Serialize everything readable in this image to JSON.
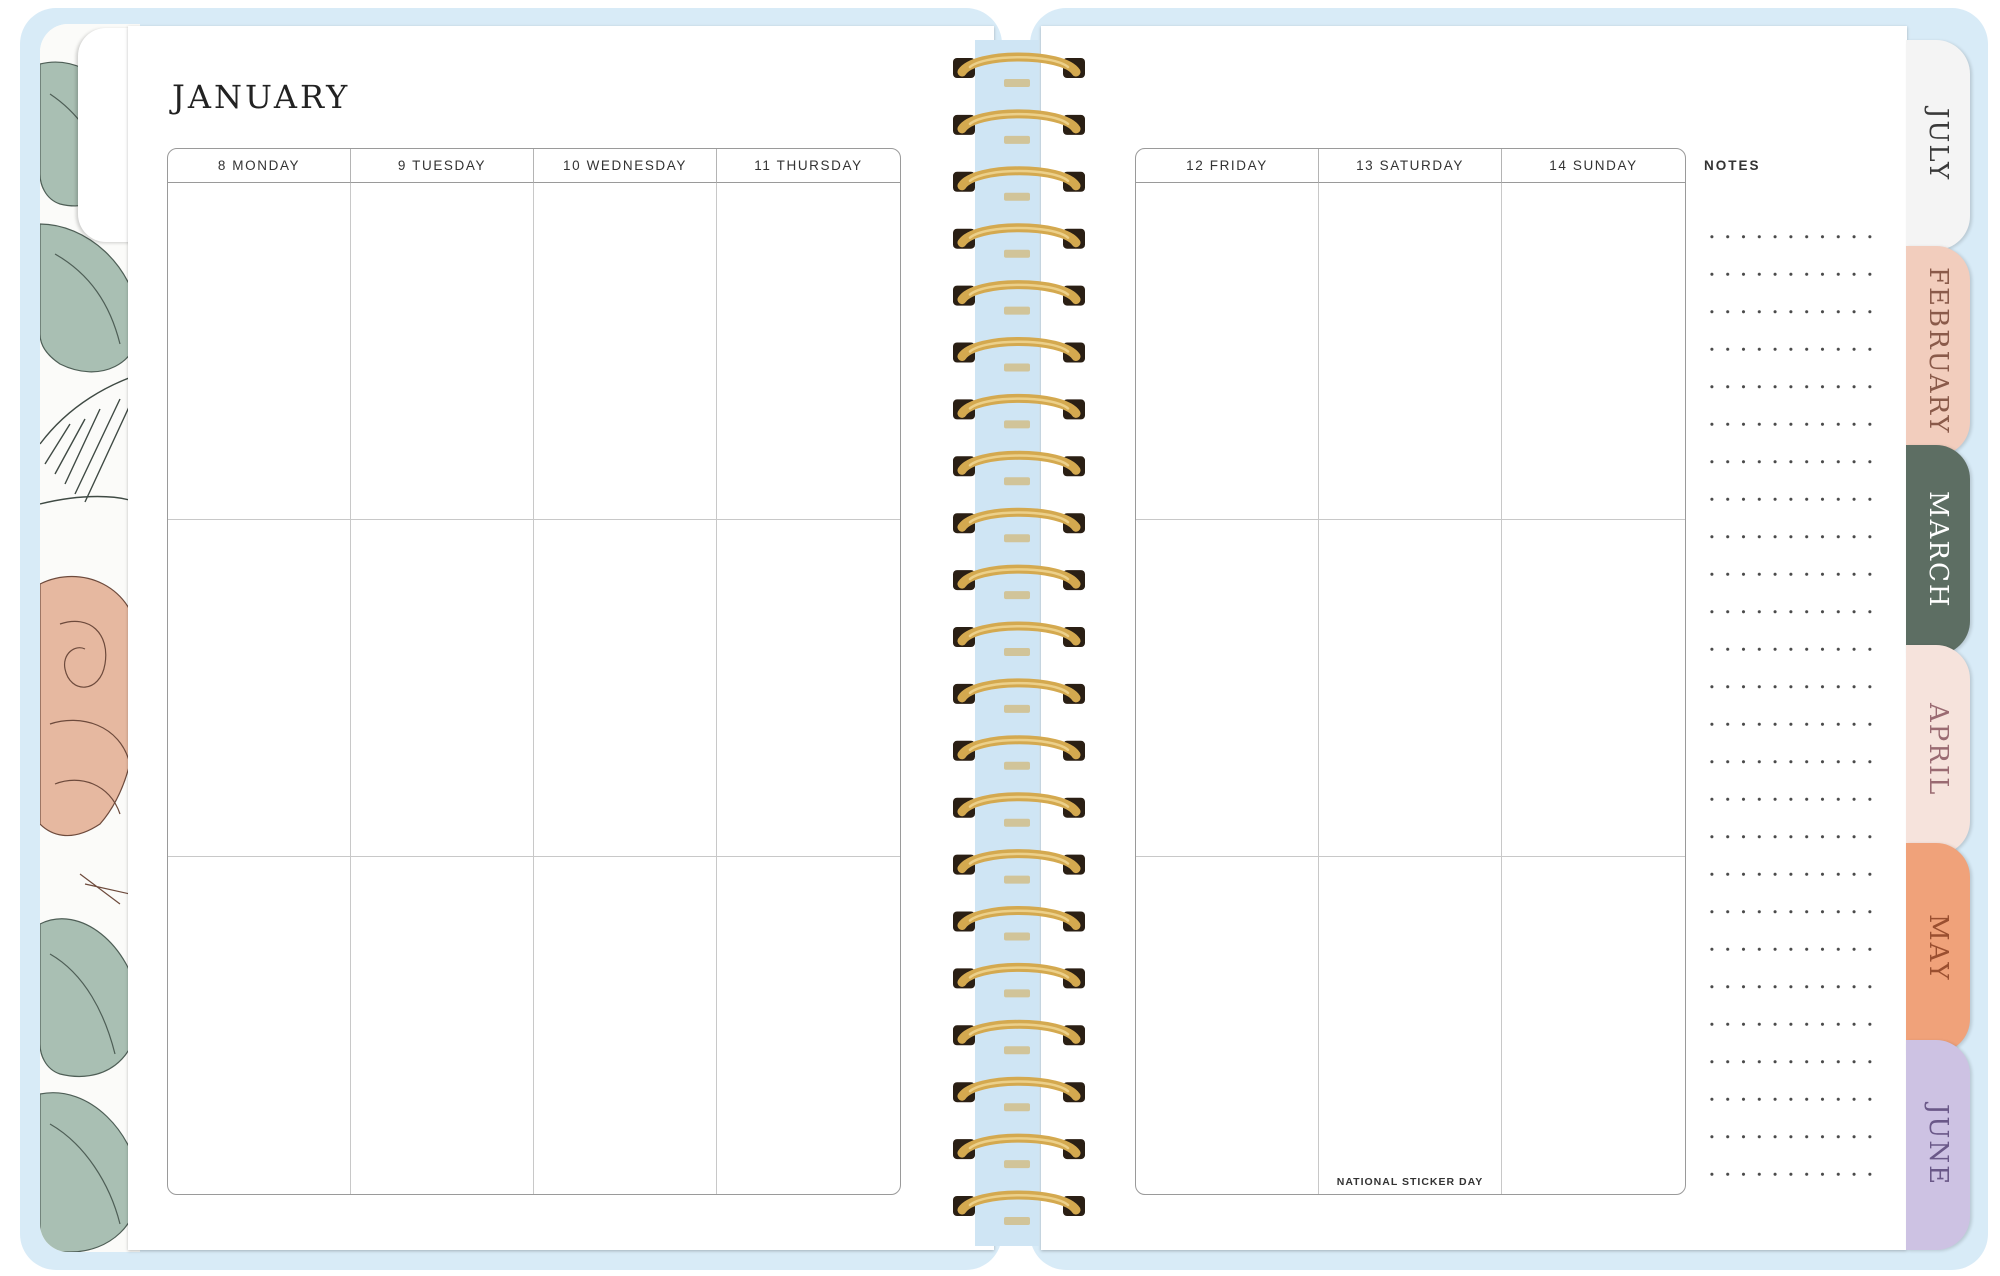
{
  "planner": {
    "month": "JANUARY",
    "left_days": [
      {
        "header": "8 MONDAY"
      },
      {
        "header": "9 TUESDAY"
      },
      {
        "header": "10 WEDNESDAY"
      },
      {
        "header": "11 THURSDAY"
      }
    ],
    "right_days": [
      {
        "header": "12 FRIDAY"
      },
      {
        "header": "13 SATURDAY",
        "holiday": "NATIONAL STICKER DAY"
      },
      {
        "header": "14 SUNDAY"
      }
    ],
    "notes_label": "NOTES"
  },
  "month_tabs": [
    {
      "label": "JULY",
      "bg": "#f4f4f4",
      "text": "#3a3a3a"
    },
    {
      "label": "FEBRUARY",
      "bg": "#f2cdbd",
      "text": "#8a5a4a"
    },
    {
      "label": "MARCH",
      "bg": "#5d6e63",
      "text": "#ffffff"
    },
    {
      "label": "APRIL",
      "bg": "#f6e3dc",
      "text": "#9a6b72"
    },
    {
      "label": "MAY",
      "bg": "#f0a27a",
      "text": "#9a4f30"
    },
    {
      "label": "JUNE",
      "bg": "#cdc2e3",
      "text": "#6a5888"
    }
  ],
  "colors": {
    "cover": "#d8ebf7",
    "spiral_gold": "#d4a94f",
    "spiral_dark": "#2a1f14",
    "leaf_green": "#a9bfb3",
    "rose_peach": "#e6b8a0"
  }
}
